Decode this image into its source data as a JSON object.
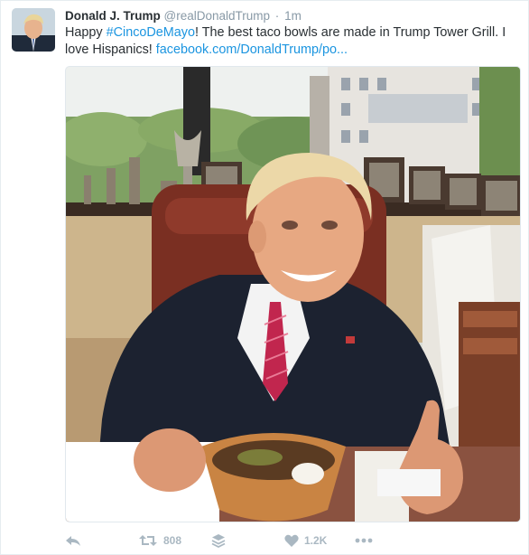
{
  "tweet": {
    "name": "Donald J. Trump",
    "handle": "@realDonaldTrump",
    "separator": "·",
    "time": "1m",
    "text_before": "Happy ",
    "hashtag": "#CincoDeMayo",
    "text_after": "! The best taco bowls are made in Trump Tower Grill. I love Hispanics! ",
    "link": "facebook.com/DonaldTrump/po..."
  },
  "actions": {
    "retweet_count": "808",
    "like_count": "1.2K"
  },
  "icons": {
    "reply": "reply-icon",
    "retweet": "retweet-icon",
    "stack": "stack-icon",
    "like": "heart-icon",
    "more": "more-icon"
  },
  "colors": {
    "link": "#1b95e0",
    "muted": "#8899a6",
    "action": "#aab8c2"
  }
}
